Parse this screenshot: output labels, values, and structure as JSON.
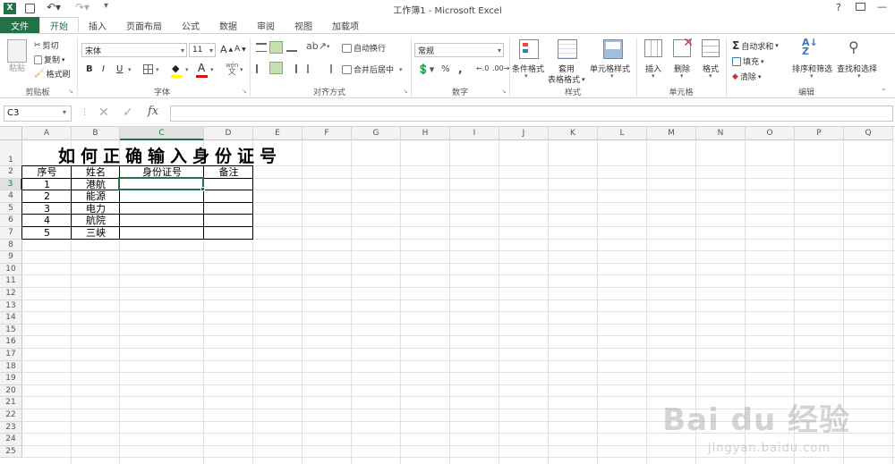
{
  "window": {
    "title": "工作簿1 - Microsoft Excel",
    "help": "?",
    "minimize": "—"
  },
  "tabs": [
    "文件",
    "开始",
    "插入",
    "页面布局",
    "公式",
    "数据",
    "审阅",
    "视图",
    "加载项"
  ],
  "active_tab": "开始",
  "ribbon": {
    "clipboard": {
      "label": "剪贴板",
      "paste": "粘贴",
      "cut": "剪切",
      "copy": "复制",
      "format_painter": "格式刷"
    },
    "font": {
      "label": "字体",
      "font_name": "宋体",
      "font_size": "11",
      "bold": "B",
      "italic": "I",
      "underline": "U",
      "grow": "A",
      "shrink": "A",
      "font_color": "A",
      "phonetic": "wén"
    },
    "alignment": {
      "label": "对齐方式",
      "wrap": "自动换行",
      "merge": "合并后居中"
    },
    "number": {
      "label": "数字",
      "format": "常规",
      "percent": "%",
      "comma": ","
    },
    "styles": {
      "label": "样式",
      "conditional": "条件格式",
      "table_format_1": "套用",
      "table_format_2": "表格格式",
      "cell_styles": "单元格样式"
    },
    "cells": {
      "label": "单元格",
      "insert": "插入",
      "delete": "删除",
      "format": "格式"
    },
    "editing": {
      "label": "编辑",
      "autosum": "自动求和",
      "fill": "填充",
      "clear": "清除",
      "sort": "排序和筛选",
      "find": "查找和选择"
    }
  },
  "formula_bar": {
    "name_box": "C3",
    "fx": "fx",
    "value": ""
  },
  "columns": [
    "A",
    "B",
    "C",
    "D",
    "E",
    "F",
    "G",
    "H",
    "I",
    "J",
    "K",
    "L",
    "M",
    "N",
    "O",
    "P",
    "Q"
  ],
  "rows": [
    "1",
    "2",
    "3",
    "4",
    "5",
    "6",
    "7",
    "8",
    "9",
    "10",
    "11",
    "12",
    "13",
    "14",
    "15",
    "16",
    "17",
    "18",
    "19",
    "20",
    "21",
    "22",
    "23",
    "24",
    "25"
  ],
  "sheet": {
    "title": "如何正确输入身份证号",
    "headers": [
      "序号",
      "姓名",
      "身份证号",
      "备注"
    ],
    "data": [
      [
        "1",
        "港航",
        "",
        ""
      ],
      [
        "2",
        "能源",
        "",
        ""
      ],
      [
        "3",
        "电力",
        "",
        ""
      ],
      [
        "4",
        "航院",
        "",
        ""
      ],
      [
        "5",
        "三峡",
        "",
        ""
      ]
    ]
  },
  "selected_cell": "C3",
  "watermark": {
    "brand": "Bai du 经验",
    "url": "jingyan.baidu.com"
  },
  "colors": {
    "accent": "#217346"
  }
}
